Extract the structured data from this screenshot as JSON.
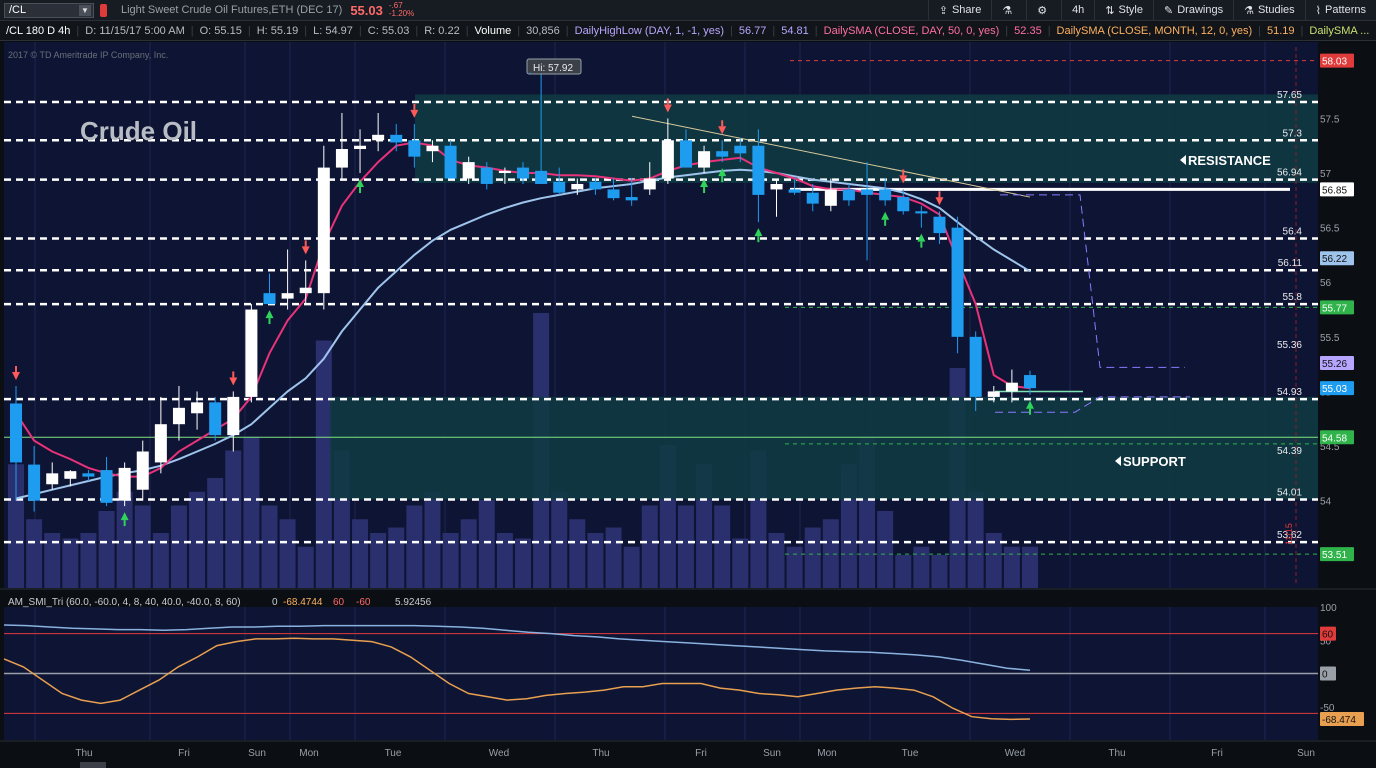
{
  "toolbar": {
    "symbol": "/CL",
    "description": "Light Sweet Crude Oil Futures,ETH (DEC 17)",
    "last_price": "55.03",
    "change_abs": "-.67",
    "change_pct": "-1.20%",
    "share_label": "Share",
    "timeframe_label": "4h",
    "style_label": "Style",
    "drawings_label": "Drawings",
    "studies_label": "Studies",
    "patterns_label": "Patterns"
  },
  "infobar": {
    "symbol_tf": "/CL 180 D 4h",
    "date": "D: 11/15/17 5:00 AM",
    "open": "O: 55.15",
    "high": "H: 55.19",
    "low": "L: 54.97",
    "close": "C: 55.03",
    "range": "R: 0.22",
    "volume_label": "Volume",
    "volume_value": "30,856",
    "hl_label": "DailyHighLow (DAY, 1, -1, yes)",
    "hl_high": "56.77",
    "hl_low": "54.81",
    "sma1_label": "DailySMA (CLOSE, DAY, 50, 0, yes)",
    "sma1_value": "52.35",
    "sma2_label": "DailySMA (CLOSE, MONTH, 12, 0, yes)",
    "sma2_value": "51.19",
    "sma3_label": "DailySMA ..."
  },
  "chart_title": "Crude Oil",
  "copyright": "2017 © TD Ameritrade IP Company, Inc.",
  "hi_label": "Hi: 57.92",
  "resistance_label": "RESISTANCE",
  "support_label": "SUPPORT",
  "date_marker": "11/15",
  "oscillator_label": "AM_SMI_Tri (60.0, -60.0, 4, 8, 40, 40.0, -40.0, 8, 60)",
  "oscillator_values": [
    "0",
    "-68.4744",
    "60",
    "-60",
    "5.92456"
  ],
  "colors": {
    "background": "#0b0f14",
    "plot_bg": "#0e1433",
    "resistance_zone": "#0f3b43",
    "support_zone": "#0f3b43",
    "up_candle": "#ffffff",
    "down_candle": "#1e9cf0",
    "sma_fast": "#e8327a",
    "sma_slow": "#9fc4ec",
    "volume": "#2a2f6e",
    "smi_fast": "#e8a050",
    "smi_slow": "#8ab2e0"
  },
  "chart_data": [
    {
      "type": "candlestick",
      "title": "Crude Oil",
      "ylim": [
        53.2,
        58.2
      ],
      "y_ticks": [
        "57.5",
        "57",
        "56.5",
        "56",
        "55.5",
        "55",
        "54.5",
        "54"
      ],
      "x_labels": [
        "Thu",
        "Fri",
        "Sun",
        "Mon",
        "Tue",
        "Wed",
        "Thu",
        "Fri",
        "Sun",
        "Mon",
        "Tue",
        "Wed",
        "Thu",
        "Fri",
        "Sun"
      ],
      "level_labels": [
        "57.65",
        "57.3",
        "56.94",
        "56.4",
        "56.11",
        "55.8",
        "55.36",
        "54.93",
        "54.39",
        "54.01",
        "53.62"
      ],
      "price_tags": [
        {
          "label": "58.03",
          "color": "#e03b3b"
        },
        {
          "label": "56.85",
          "color": "#ffffff"
        },
        {
          "label": "56.22",
          "color": "#9fc4ec"
        },
        {
          "label": "55.77",
          "color": "#2fb34a"
        },
        {
          "label": "55.26",
          "color": "#b7a6ff"
        },
        {
          "label": "55.03",
          "color": "#1e9cf0"
        },
        {
          "label": "54.58",
          "color": "#2fb34a"
        },
        {
          "label": "53.51",
          "color": "#2fb34a"
        }
      ],
      "levels_dashed_white": [
        57.65,
        57.3,
        56.94,
        56.4,
        56.11,
        55.8,
        54.93,
        54.01,
        53.62
      ],
      "level_solid_white": 56.85,
      "resistance_zone": [
        56.91,
        57.72
      ],
      "support_zone": [
        54.01,
        54.95
      ],
      "candles": [
        {
          "o": 54.89,
          "h": 55.05,
          "l": 54.0,
          "c": 54.35
        },
        {
          "o": 54.33,
          "h": 54.5,
          "l": 53.9,
          "c": 54.0
        },
        {
          "o": 54.15,
          "h": 54.35,
          "l": 54.1,
          "c": 54.25
        },
        {
          "o": 54.2,
          "h": 54.28,
          "l": 54.13,
          "c": 54.27
        },
        {
          "o": 54.25,
          "h": 54.28,
          "l": 54.18,
          "c": 54.22
        },
        {
          "o": 54.28,
          "h": 54.4,
          "l": 53.95,
          "c": 53.98
        },
        {
          "o": 54.0,
          "h": 54.35,
          "l": 53.95,
          "c": 54.3
        },
        {
          "o": 54.1,
          "h": 54.55,
          "l": 54.0,
          "c": 54.45
        },
        {
          "o": 54.35,
          "h": 54.95,
          "l": 54.25,
          "c": 54.7
        },
        {
          "o": 54.7,
          "h": 55.05,
          "l": 54.55,
          "c": 54.85
        },
        {
          "o": 54.8,
          "h": 55.0,
          "l": 54.65,
          "c": 54.9
        },
        {
          "o": 54.9,
          "h": 54.95,
          "l": 54.55,
          "c": 54.6
        },
        {
          "o": 54.6,
          "h": 55.0,
          "l": 54.45,
          "c": 54.95
        },
        {
          "o": 54.95,
          "h": 55.8,
          "l": 54.9,
          "c": 55.75
        },
        {
          "o": 55.9,
          "h": 56.08,
          "l": 55.8,
          "c": 55.8
        },
        {
          "o": 55.85,
          "h": 56.3,
          "l": 55.75,
          "c": 55.9
        },
        {
          "o": 55.9,
          "h": 56.2,
          "l": 55.8,
          "c": 55.95
        },
        {
          "o": 55.9,
          "h": 57.25,
          "l": 55.75,
          "c": 57.05
        },
        {
          "o": 57.05,
          "h": 57.55,
          "l": 56.95,
          "c": 57.22
        },
        {
          "o": 57.22,
          "h": 57.4,
          "l": 57.0,
          "c": 57.25
        },
        {
          "o": 57.3,
          "h": 57.55,
          "l": 57.2,
          "c": 57.35
        },
        {
          "o": 57.35,
          "h": 57.45,
          "l": 57.2,
          "c": 57.28
        },
        {
          "o": 57.3,
          "h": 57.45,
          "l": 57.05,
          "c": 57.15
        },
        {
          "o": 57.2,
          "h": 57.3,
          "l": 57.1,
          "c": 57.25
        },
        {
          "o": 57.25,
          "h": 57.3,
          "l": 56.95,
          "c": 56.95
        },
        {
          "o": 56.95,
          "h": 57.15,
          "l": 56.9,
          "c": 57.1
        },
        {
          "o": 57.05,
          "h": 57.1,
          "l": 56.85,
          "c": 56.9
        },
        {
          "o": 57.0,
          "h": 57.05,
          "l": 56.9,
          "c": 57.02
        },
        {
          "o": 57.05,
          "h": 57.1,
          "l": 56.9,
          "c": 56.95
        },
        {
          "o": 57.02,
          "h": 57.92,
          "l": 56.9,
          "c": 56.9
        },
        {
          "o": 56.92,
          "h": 57.05,
          "l": 56.8,
          "c": 56.82
        },
        {
          "o": 56.85,
          "h": 56.95,
          "l": 56.8,
          "c": 56.9
        },
        {
          "o": 56.92,
          "h": 56.95,
          "l": 56.8,
          "c": 56.85
        },
        {
          "o": 56.85,
          "h": 56.95,
          "l": 56.75,
          "c": 56.77
        },
        {
          "o": 56.78,
          "h": 56.95,
          "l": 56.7,
          "c": 56.75
        },
        {
          "o": 56.85,
          "h": 57.1,
          "l": 56.8,
          "c": 56.95
        },
        {
          "o": 56.95,
          "h": 57.5,
          "l": 56.9,
          "c": 57.3
        },
        {
          "o": 57.3,
          "h": 57.4,
          "l": 57.05,
          "c": 57.05
        },
        {
          "o": 57.05,
          "h": 57.25,
          "l": 57.0,
          "c": 57.2
        },
        {
          "o": 57.2,
          "h": 57.3,
          "l": 57.1,
          "c": 57.15
        },
        {
          "o": 57.25,
          "h": 57.32,
          "l": 57.1,
          "c": 57.18
        },
        {
          "o": 57.25,
          "h": 57.4,
          "l": 56.55,
          "c": 56.8
        },
        {
          "o": 56.85,
          "h": 56.95,
          "l": 56.6,
          "c": 56.9
        },
        {
          "o": 56.85,
          "h": 56.95,
          "l": 56.8,
          "c": 56.82
        },
        {
          "o": 56.82,
          "h": 56.9,
          "l": 56.65,
          "c": 56.72
        },
        {
          "o": 56.7,
          "h": 56.95,
          "l": 56.65,
          "c": 56.85
        },
        {
          "o": 56.85,
          "h": 56.9,
          "l": 56.7,
          "c": 56.75
        },
        {
          "o": 56.85,
          "h": 57.1,
          "l": 56.2,
          "c": 56.8
        },
        {
          "o": 56.85,
          "h": 56.95,
          "l": 56.7,
          "c": 56.75
        },
        {
          "o": 56.78,
          "h": 56.85,
          "l": 56.62,
          "c": 56.65
        },
        {
          "o": 56.65,
          "h": 56.7,
          "l": 56.5,
          "c": 56.63
        },
        {
          "o": 56.6,
          "h": 56.65,
          "l": 56.35,
          "c": 56.45
        },
        {
          "o": 56.5,
          "h": 56.6,
          "l": 55.35,
          "c": 55.5
        },
        {
          "o": 55.5,
          "h": 55.55,
          "l": 54.82,
          "c": 54.95
        },
        {
          "o": 54.95,
          "h": 55.05,
          "l": 54.9,
          "c": 55.0
        },
        {
          "o": 55.0,
          "h": 55.2,
          "l": 54.9,
          "c": 55.08
        },
        {
          "o": 55.15,
          "h": 55.19,
          "l": 54.97,
          "c": 55.03
        }
      ],
      "volume": [
        0.45,
        0.25,
        0.2,
        0.18,
        0.2,
        0.28,
        0.35,
        0.3,
        0.2,
        0.3,
        0.35,
        0.4,
        0.5,
        0.55,
        0.3,
        0.25,
        0.15,
        0.9,
        0.5,
        0.25,
        0.2,
        0.22,
        0.3,
        0.35,
        0.2,
        0.25,
        0.32,
        0.2,
        0.18,
        1.0,
        0.35,
        0.25,
        0.2,
        0.22,
        0.15,
        0.3,
        0.52,
        0.3,
        0.45,
        0.3,
        0.18,
        0.5,
        0.2,
        0.15,
        0.22,
        0.25,
        0.45,
        0.55,
        0.28,
        0.12,
        0.15,
        0.12,
        0.8,
        0.35,
        0.2,
        0.15,
        0.15
      ],
      "sma_fast": [
        54.8,
        54.55,
        54.45,
        54.38,
        54.3,
        54.25,
        54.22,
        54.22,
        54.3,
        54.45,
        54.55,
        54.65,
        54.75,
        54.95,
        55.35,
        55.65,
        55.85,
        56.35,
        56.7,
        56.92,
        57.1,
        57.25,
        57.28,
        57.25,
        57.12,
        57.07,
        57.05,
        57.02,
        57.0,
        57.0,
        56.98,
        56.98,
        56.97,
        56.95,
        56.93,
        56.95,
        57.02,
        57.07,
        57.1,
        57.12,
        57.14,
        57.05,
        57.0,
        56.95,
        56.88,
        56.85,
        56.85,
        56.82,
        56.8,
        56.78,
        56.72,
        56.62,
        56.2,
        55.8,
        55.15,
        55.05,
        55.03
      ],
      "sma_slow": [
        54.02,
        54.06,
        54.1,
        54.14,
        54.18,
        54.22,
        54.25,
        54.28,
        54.32,
        54.38,
        54.45,
        54.52,
        54.6,
        54.7,
        54.85,
        55.0,
        55.12,
        55.3,
        55.55,
        55.75,
        55.95,
        56.1,
        56.25,
        56.38,
        56.48,
        56.55,
        56.62,
        56.68,
        56.73,
        56.77,
        56.8,
        56.83,
        56.86,
        56.88,
        56.9,
        56.93,
        56.96,
        56.98,
        57.0,
        57.02,
        57.03,
        57.02,
        57.0,
        56.97,
        56.94,
        56.92,
        56.9,
        56.88,
        56.86,
        56.82,
        56.76,
        56.68,
        56.55,
        56.42,
        56.3,
        56.2,
        56.1
      ]
    },
    {
      "type": "line",
      "title": "AM_SMI_Tri (60.0, -60.0, 4, 8, 40, 40.0, -40.0, 8, 60)",
      "ylim": [
        -100,
        100
      ],
      "y_ticks": [
        "100",
        "50",
        "0",
        "-50"
      ],
      "reference_tags": [
        {
          "label": "60",
          "color": "#e03b3b"
        },
        {
          "label": "0",
          "color": "#9aa0a8"
        },
        {
          "label": "-68.474",
          "color": "#e8a050"
        }
      ],
      "series": [
        {
          "values": [
            22,
            10,
            -10,
            -30,
            -40,
            -45,
            -40,
            -25,
            -10,
            10,
            25,
            42,
            48,
            52,
            52,
            53,
            52,
            52,
            50,
            48,
            40,
            25,
            5,
            -15,
            -30,
            -35,
            -40,
            -38,
            -33,
            -30,
            -28,
            -25,
            -20,
            -20,
            -15,
            -15,
            -15,
            -22,
            -25,
            -30,
            -32,
            -35,
            -30,
            -25,
            -22,
            -20,
            -22,
            -25,
            -35,
            -52,
            -65,
            -68,
            -69,
            -68.47
          ]
        },
        {
          "values": [
            73,
            72,
            70,
            68,
            67,
            66,
            66,
            65,
            66,
            68,
            70,
            70,
            71,
            71,
            72,
            72,
            72,
            72,
            72,
            71,
            70,
            68,
            65,
            62,
            60,
            57,
            55,
            52,
            50,
            48,
            46,
            44,
            42,
            40,
            38,
            36,
            34,
            33,
            32,
            30,
            28,
            25,
            20,
            14,
            8,
            5
          ]
        }
      ]
    }
  ]
}
